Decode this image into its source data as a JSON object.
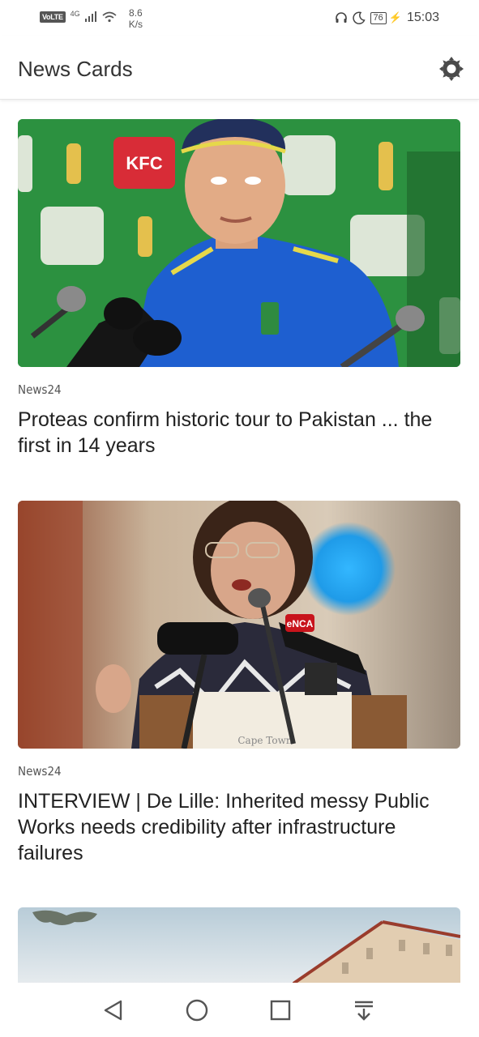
{
  "status_bar": {
    "volte": "VoLTE",
    "network": "4G",
    "speed_value": "8.6",
    "speed_unit": "K/s",
    "battery": "76",
    "time": "15:03"
  },
  "app_bar": {
    "title": "News Cards",
    "settings_icon": "gear-icon"
  },
  "articles": [
    {
      "source": "News24",
      "title": "Proteas confirm historic tour to Pakistan ... the first in 14 years",
      "image": "cricket-coach-press-conference"
    },
    {
      "source": "News24",
      "title": "INTERVIEW | De Lille: Inherited messy Public Works needs credibility after infrastructure failures",
      "image": "politician-speaking-at-podium"
    },
    {
      "image": "building-and-sky"
    }
  ],
  "nav_bar": {
    "icons": [
      "back-triangle-icon",
      "home-circle-icon",
      "recents-square-icon",
      "notification-down-icon"
    ]
  }
}
